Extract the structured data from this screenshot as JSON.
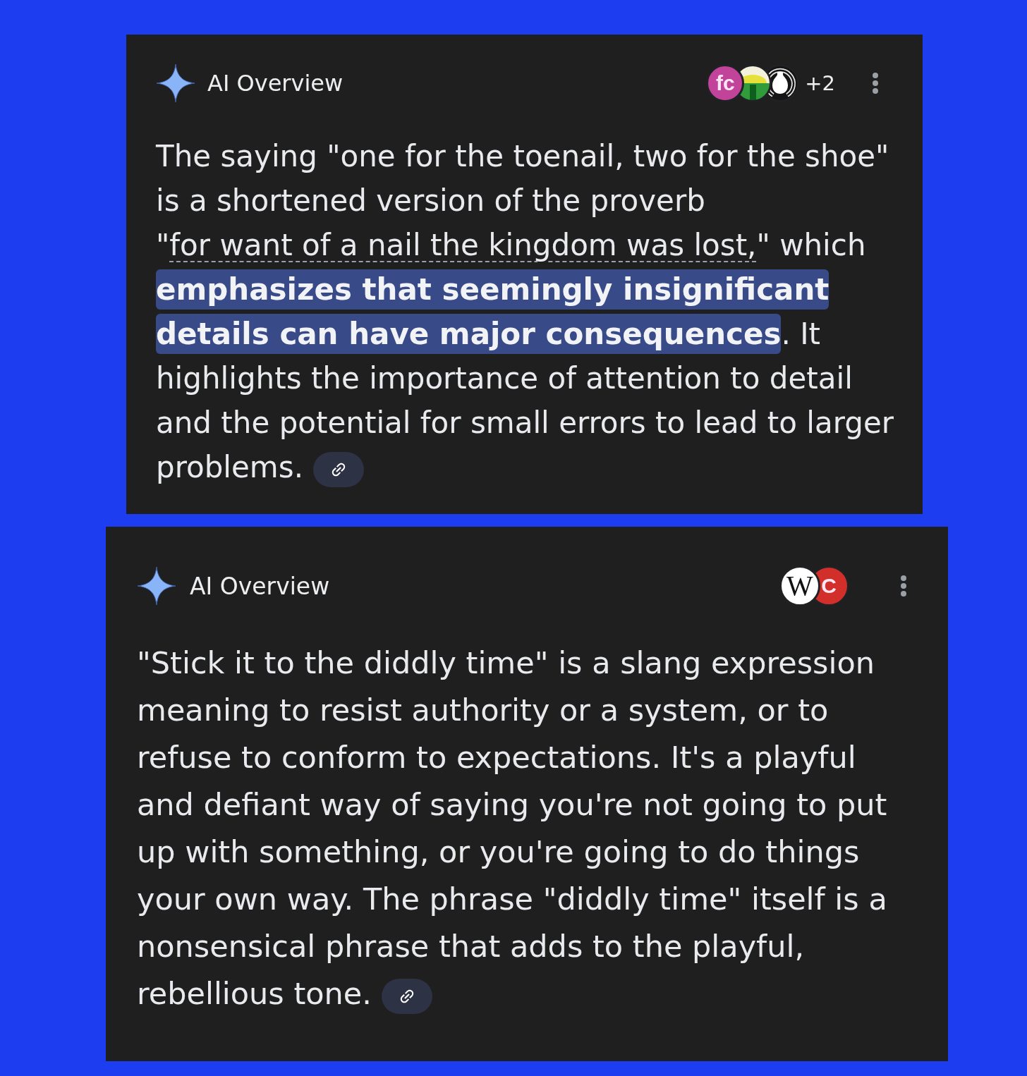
{
  "cards": [
    {
      "title": "AI Overview",
      "sources": [
        {
          "kind": "monogram",
          "text": "fc",
          "color": "#c2449a"
        },
        {
          "kind": "landscape"
        },
        {
          "kind": "horseshoe"
        }
      ],
      "more_sources": "+2",
      "runs": [
        {
          "kind": "text",
          "text": "The saying \"one for the toenail, two for the shoe\" is a shortened version of the proverb \""
        },
        {
          "kind": "link",
          "text": "for want of a nail the kingdom was lost,"
        },
        {
          "kind": "text",
          "text": "\" which "
        },
        {
          "kind": "highlight",
          "text": "emphasizes that seemingly insignificant details can have major consequences"
        },
        {
          "kind": "text",
          "text": ". It highlights the importance of attention to detail and the potential for small errors to lead to larger problems."
        }
      ]
    },
    {
      "title": "AI Overview",
      "sources": [
        {
          "kind": "serif-monogram",
          "text": "W",
          "color": "#ffffff"
        },
        {
          "kind": "monogram",
          "text": "C",
          "color": "#d32f2a"
        }
      ],
      "runs": [
        {
          "kind": "text",
          "text": "\"Stick it to the diddly time\" is a slang expression meaning to resist authority or a system, or to refuse to conform to expectations. It's a playful and defiant way of saying you're not going to put up with something, or you're going to do things your own way. The phrase \"diddly time\" itself is a nonsensical phrase that adds to the playful, rebellious tone."
        }
      ]
    }
  ]
}
